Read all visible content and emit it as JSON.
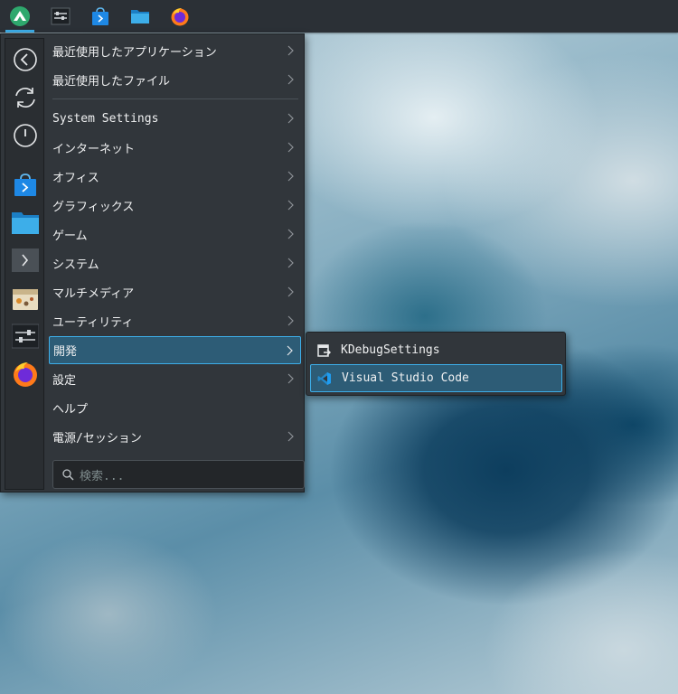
{
  "panel": {
    "launcher_icon": "app-launcher-icon",
    "tasks": [
      {
        "icon": "system-monitor-icon"
      },
      {
        "icon": "discover-store-icon"
      },
      {
        "icon": "file-manager-icon"
      },
      {
        "icon": "firefox-icon"
      }
    ]
  },
  "sidebar": {
    "items": [
      {
        "icon": "back-icon"
      },
      {
        "icon": "refresh-icon"
      },
      {
        "icon": "power-icon"
      },
      {
        "icon": "discover-store-icon"
      },
      {
        "icon": "folder-icon"
      },
      {
        "icon": "terminal-icon"
      },
      {
        "icon": "archive-icon"
      },
      {
        "icon": "settings-sliders-icon"
      },
      {
        "icon": "firefox-icon"
      }
    ]
  },
  "menu": {
    "recent": [
      {
        "label": "最近使用したアプリケーション"
      },
      {
        "label": "最近使用したファイル"
      }
    ],
    "categories": [
      {
        "label": "System Settings"
      },
      {
        "label": "インターネット"
      },
      {
        "label": "オフィス"
      },
      {
        "label": "グラフィックス"
      },
      {
        "label": "ゲーム"
      },
      {
        "label": "システム"
      },
      {
        "label": "マルチメディア"
      },
      {
        "label": "ユーティリティ"
      },
      {
        "label": "開発"
      },
      {
        "label": "設定"
      },
      {
        "label": "ヘルプ"
      },
      {
        "label": "電源/セッション"
      }
    ],
    "selected": "開発"
  },
  "search": {
    "placeholder": "検索..."
  },
  "submenu": {
    "items": [
      {
        "label": "KDebugSettings"
      },
      {
        "label": "Visual Studio Code"
      }
    ]
  },
  "colors": {
    "accent": "#3daee9",
    "panel_bg": "#2b3036",
    "menu_bg": "#31363b",
    "selection_bg": "#2d5c76"
  }
}
